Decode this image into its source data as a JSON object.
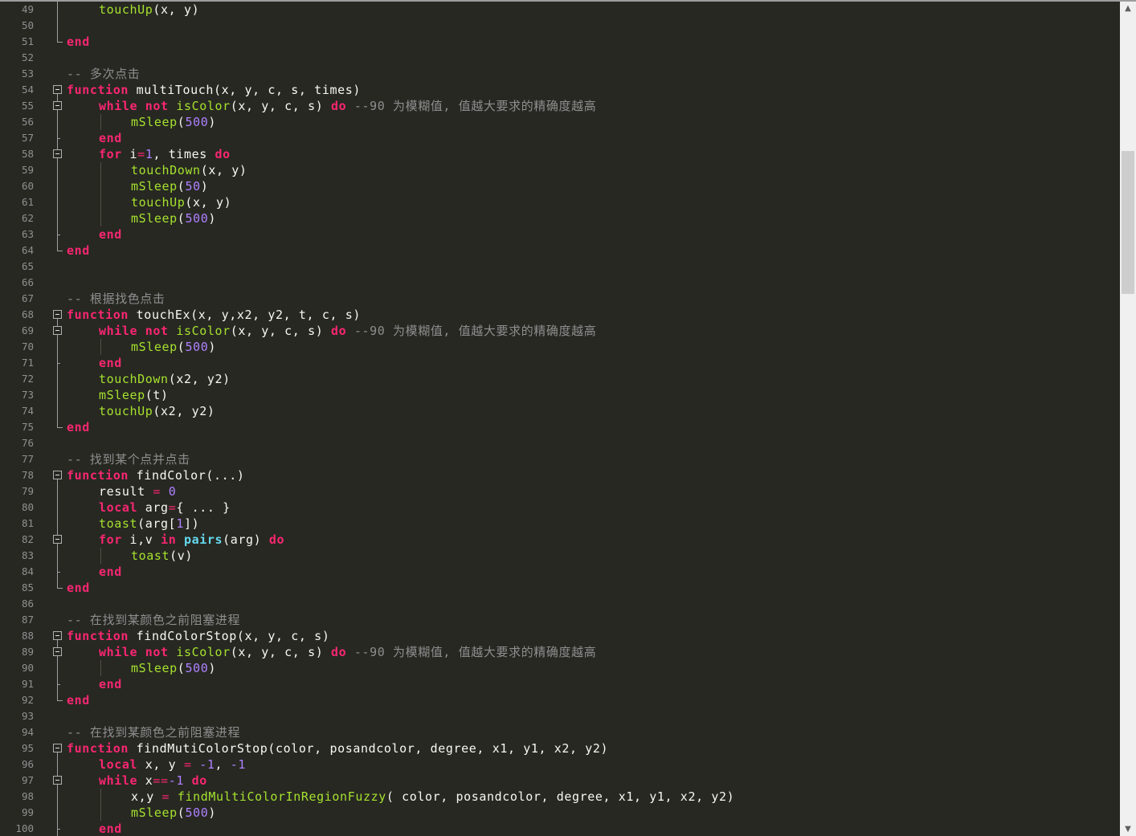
{
  "editor": {
    "language": "lua",
    "first_line": 49,
    "lines": [
      {
        "n": "49",
        "fold": "mid",
        "indent": 1,
        "tokens": [
          [
            "f",
            "touchUp"
          ],
          [
            "p",
            "(x, y)"
          ]
        ]
      },
      {
        "n": "50",
        "fold": "mid",
        "indent": 0,
        "tokens": []
      },
      {
        "n": "51",
        "fold": "end",
        "indent": 0,
        "tokens": [
          [
            "k",
            "end"
          ]
        ]
      },
      {
        "n": "52",
        "fold": "none",
        "indent": 0,
        "tokens": []
      },
      {
        "n": "53",
        "fold": "none",
        "indent": 0,
        "tokens": [
          [
            "c",
            "-- 多次点击"
          ]
        ]
      },
      {
        "n": "54",
        "fold": "box",
        "indent": 0,
        "tokens": [
          [
            "k",
            "function"
          ],
          [
            "p",
            " multiTouch(x, y, c, s, times)"
          ]
        ]
      },
      {
        "n": "55",
        "fold": "box",
        "indent": 1,
        "tokens": [
          [
            "k",
            "while"
          ],
          [
            "p",
            " "
          ],
          [
            "k",
            "not"
          ],
          [
            "p",
            " "
          ],
          [
            "f",
            "isColor"
          ],
          [
            "p",
            "(x, y, c, s) "
          ],
          [
            "k",
            "do"
          ],
          [
            "p",
            " "
          ],
          [
            "c",
            "--90 为模糊值, 值越大要求的精确度越高"
          ]
        ]
      },
      {
        "n": "56",
        "fold": "mid",
        "indent": 2,
        "tokens": [
          [
            "f",
            "mSleep"
          ],
          [
            "p",
            "("
          ],
          [
            "n",
            "500"
          ],
          [
            "p",
            ")"
          ]
        ]
      },
      {
        "n": "57",
        "fold": "subend",
        "indent": 1,
        "tokens": [
          [
            "k",
            "end"
          ]
        ]
      },
      {
        "n": "58",
        "fold": "box",
        "indent": 1,
        "tokens": [
          [
            "k",
            "for"
          ],
          [
            "p",
            " i"
          ],
          [
            "o",
            "="
          ],
          [
            "n",
            "1"
          ],
          [
            "p",
            ", times "
          ],
          [
            "k",
            "do"
          ]
        ]
      },
      {
        "n": "59",
        "fold": "mid",
        "indent": 2,
        "tokens": [
          [
            "f",
            "touchDown"
          ],
          [
            "p",
            "(x, y)"
          ]
        ]
      },
      {
        "n": "60",
        "fold": "mid",
        "indent": 2,
        "tokens": [
          [
            "f",
            "mSleep"
          ],
          [
            "p",
            "("
          ],
          [
            "n",
            "50"
          ],
          [
            "p",
            ")"
          ]
        ]
      },
      {
        "n": "61",
        "fold": "mid",
        "indent": 2,
        "tokens": [
          [
            "f",
            "touchUp"
          ],
          [
            "p",
            "(x, y)"
          ]
        ]
      },
      {
        "n": "62",
        "fold": "mid",
        "indent": 2,
        "tokens": [
          [
            "f",
            "mSleep"
          ],
          [
            "p",
            "("
          ],
          [
            "n",
            "500"
          ],
          [
            "p",
            ")"
          ]
        ]
      },
      {
        "n": "63",
        "fold": "subend",
        "indent": 1,
        "tokens": [
          [
            "k",
            "end"
          ]
        ]
      },
      {
        "n": "64",
        "fold": "end",
        "indent": 0,
        "tokens": [
          [
            "k",
            "end"
          ]
        ]
      },
      {
        "n": "65",
        "fold": "none",
        "indent": 0,
        "tokens": []
      },
      {
        "n": "66",
        "fold": "none",
        "indent": 0,
        "tokens": []
      },
      {
        "n": "67",
        "fold": "none",
        "indent": 0,
        "tokens": [
          [
            "c",
            "-- 根据找色点击"
          ]
        ]
      },
      {
        "n": "68",
        "fold": "box",
        "indent": 0,
        "tokens": [
          [
            "k",
            "function"
          ],
          [
            "p",
            " touchEx(x, y,x2, y2, t, c, s)"
          ]
        ]
      },
      {
        "n": "69",
        "fold": "box",
        "indent": 1,
        "tokens": [
          [
            "k",
            "while"
          ],
          [
            "p",
            " "
          ],
          [
            "k",
            "not"
          ],
          [
            "p",
            " "
          ],
          [
            "f",
            "isColor"
          ],
          [
            "p",
            "(x, y, c, s) "
          ],
          [
            "k",
            "do"
          ],
          [
            "p",
            " "
          ],
          [
            "c",
            "--90 为模糊值, 值越大要求的精确度越高"
          ]
        ]
      },
      {
        "n": "70",
        "fold": "mid",
        "indent": 2,
        "tokens": [
          [
            "f",
            "mSleep"
          ],
          [
            "p",
            "("
          ],
          [
            "n",
            "500"
          ],
          [
            "p",
            ")"
          ]
        ]
      },
      {
        "n": "71",
        "fold": "subend",
        "indent": 1,
        "tokens": [
          [
            "k",
            "end"
          ]
        ]
      },
      {
        "n": "72",
        "fold": "mid",
        "indent": 1,
        "tokens": [
          [
            "f",
            "touchDown"
          ],
          [
            "p",
            "(x2, y2)"
          ]
        ]
      },
      {
        "n": "73",
        "fold": "mid",
        "indent": 1,
        "tokens": [
          [
            "f",
            "mSleep"
          ],
          [
            "p",
            "(t)"
          ]
        ]
      },
      {
        "n": "74",
        "fold": "mid",
        "indent": 1,
        "tokens": [
          [
            "f",
            "touchUp"
          ],
          [
            "p",
            "(x2, y2)"
          ]
        ]
      },
      {
        "n": "75",
        "fold": "end",
        "indent": 0,
        "tokens": [
          [
            "k",
            "end"
          ]
        ]
      },
      {
        "n": "76",
        "fold": "none",
        "indent": 0,
        "tokens": []
      },
      {
        "n": "77",
        "fold": "none",
        "indent": 0,
        "tokens": [
          [
            "c",
            "-- 找到某个点并点击"
          ]
        ]
      },
      {
        "n": "78",
        "fold": "box",
        "indent": 0,
        "tokens": [
          [
            "k",
            "function"
          ],
          [
            "p",
            " findColor(...)"
          ]
        ]
      },
      {
        "n": "79",
        "fold": "mid",
        "indent": 1,
        "tokens": [
          [
            "p",
            "result "
          ],
          [
            "o",
            "="
          ],
          [
            "p",
            " "
          ],
          [
            "n",
            "0"
          ]
        ]
      },
      {
        "n": "80",
        "fold": "mid",
        "indent": 1,
        "tokens": [
          [
            "k",
            "local"
          ],
          [
            "p",
            " arg"
          ],
          [
            "o",
            "="
          ],
          [
            "p",
            "{ ... }"
          ]
        ]
      },
      {
        "n": "81",
        "fold": "mid",
        "indent": 1,
        "tokens": [
          [
            "f",
            "toast"
          ],
          [
            "p",
            "(arg["
          ],
          [
            "n",
            "1"
          ],
          [
            "p",
            "])"
          ]
        ]
      },
      {
        "n": "82",
        "fold": "box",
        "indent": 1,
        "tokens": [
          [
            "k",
            "for"
          ],
          [
            "p",
            " i,v "
          ],
          [
            "k",
            "in"
          ],
          [
            "p",
            " "
          ],
          [
            "b",
            "pairs"
          ],
          [
            "p",
            "(arg) "
          ],
          [
            "k",
            "do"
          ]
        ]
      },
      {
        "n": "83",
        "fold": "mid",
        "indent": 2,
        "tokens": [
          [
            "f",
            "toast"
          ],
          [
            "p",
            "(v)"
          ]
        ]
      },
      {
        "n": "84",
        "fold": "subend",
        "indent": 1,
        "tokens": [
          [
            "k",
            "end"
          ]
        ]
      },
      {
        "n": "85",
        "fold": "end",
        "indent": 0,
        "tokens": [
          [
            "k",
            "end"
          ]
        ]
      },
      {
        "n": "86",
        "fold": "none",
        "indent": 0,
        "tokens": []
      },
      {
        "n": "87",
        "fold": "none",
        "indent": 0,
        "tokens": [
          [
            "c",
            "-- 在找到某颜色之前阻塞进程"
          ]
        ]
      },
      {
        "n": "88",
        "fold": "box",
        "indent": 0,
        "tokens": [
          [
            "k",
            "function"
          ],
          [
            "p",
            " findColorStop(x, y, c, s)"
          ]
        ]
      },
      {
        "n": "89",
        "fold": "box",
        "indent": 1,
        "tokens": [
          [
            "k",
            "while"
          ],
          [
            "p",
            " "
          ],
          [
            "k",
            "not"
          ],
          [
            "p",
            " "
          ],
          [
            "f",
            "isColor"
          ],
          [
            "p",
            "(x, y, c, s) "
          ],
          [
            "k",
            "do"
          ],
          [
            "p",
            " "
          ],
          [
            "c",
            "--90 为模糊值, 值越大要求的精确度越高"
          ]
        ]
      },
      {
        "n": "90",
        "fold": "mid",
        "indent": 2,
        "tokens": [
          [
            "f",
            "mSleep"
          ],
          [
            "p",
            "("
          ],
          [
            "n",
            "500"
          ],
          [
            "p",
            ")"
          ]
        ]
      },
      {
        "n": "91",
        "fold": "subend",
        "indent": 1,
        "tokens": [
          [
            "k",
            "end"
          ]
        ]
      },
      {
        "n": "92",
        "fold": "end",
        "indent": 0,
        "tokens": [
          [
            "k",
            "end"
          ]
        ]
      },
      {
        "n": "93",
        "fold": "none",
        "indent": 0,
        "tokens": []
      },
      {
        "n": "94",
        "fold": "none",
        "indent": 0,
        "tokens": [
          [
            "c",
            "-- 在找到某颜色之前阻塞进程"
          ]
        ]
      },
      {
        "n": "95",
        "fold": "box",
        "indent": 0,
        "tokens": [
          [
            "k",
            "function"
          ],
          [
            "p",
            " findMutiColorStop(color, posandcolor, degree, x1, y1, x2, y2)"
          ]
        ]
      },
      {
        "n": "96",
        "fold": "mid",
        "indent": 1,
        "tokens": [
          [
            "k",
            "local"
          ],
          [
            "p",
            " x, y "
          ],
          [
            "o",
            "="
          ],
          [
            "p",
            " "
          ],
          [
            "n",
            "-1"
          ],
          [
            "p",
            ", "
          ],
          [
            "n",
            "-1"
          ]
        ]
      },
      {
        "n": "97",
        "fold": "box",
        "indent": 1,
        "tokens": [
          [
            "k",
            "while"
          ],
          [
            "p",
            " x"
          ],
          [
            "o",
            "=="
          ],
          [
            "n",
            "-1"
          ],
          [
            "p",
            " "
          ],
          [
            "k",
            "do"
          ]
        ]
      },
      {
        "n": "98",
        "fold": "mid",
        "indent": 2,
        "tokens": [
          [
            "p",
            "x,y "
          ],
          [
            "o",
            "="
          ],
          [
            "p",
            " "
          ],
          [
            "f",
            "findMultiColorInRegionFuzzy"
          ],
          [
            "p",
            "( color, posandcolor, degree, x1, y1, x2, y2)"
          ]
        ]
      },
      {
        "n": "99",
        "fold": "mid",
        "indent": 2,
        "tokens": [
          [
            "f",
            "mSleep"
          ],
          [
            "p",
            "("
          ],
          [
            "n",
            "500"
          ],
          [
            "p",
            ")"
          ]
        ]
      },
      {
        "n": "100",
        "fold": "subend",
        "indent": 1,
        "tokens": [
          [
            "k",
            "end"
          ]
        ]
      }
    ]
  },
  "scrollbar": {
    "up_icon": "arrow-up-icon",
    "down_icon": "arrow-down-icon",
    "up_glyph": "▲",
    "down_glyph": "▼",
    "position_fraction": 0.18
  },
  "colors": {
    "background": "#272822",
    "keyword": "#f92672",
    "function": "#a6e22e",
    "number": "#ae81ff",
    "comment": "#8e8e8e",
    "builtin": "#66d9ef",
    "plain": "#f8f8f2",
    "line_number": "#909090"
  }
}
